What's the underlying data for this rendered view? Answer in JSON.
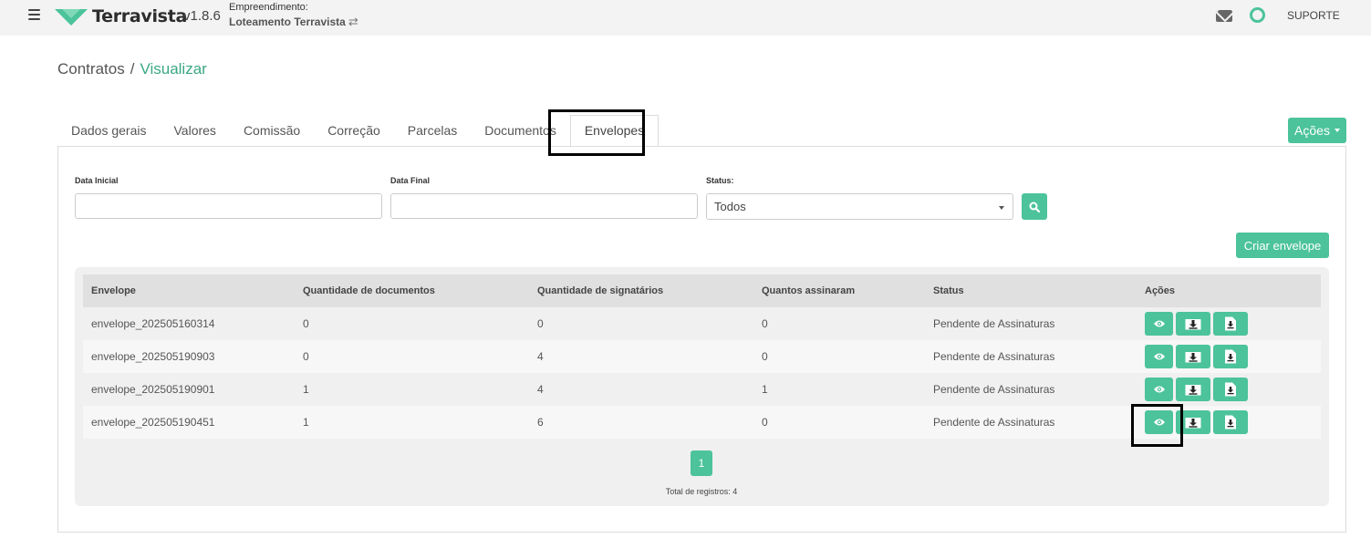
{
  "header": {
    "app_name": "Terravista",
    "version": "v1.8.6",
    "empreendimento_label": "Empreendimento:",
    "empreendimento_name": "Loteamento Terravista",
    "swap_glyph": "⇄",
    "support_label": "SUPORTE",
    "brand_color": "#4cc39a"
  },
  "breadcrumb": {
    "parent": "Contratos",
    "separator": "/",
    "current": "Visualizar"
  },
  "tabs": [
    {
      "label": "Dados gerais"
    },
    {
      "label": "Valores"
    },
    {
      "label": "Comissão"
    },
    {
      "label": "Correção"
    },
    {
      "label": "Parcelas"
    },
    {
      "label": "Documentos"
    },
    {
      "label": "Envelopes",
      "active": true
    }
  ],
  "actions_button": "Ações",
  "filters": {
    "data_inicial_label": "Data Inicial",
    "data_inicial_value": "",
    "data_final_label": "Data Final",
    "data_final_value": "",
    "status_label": "Status:",
    "status_value": "Todos"
  },
  "create_button": "Criar envelope",
  "table": {
    "headers": [
      "Envelope",
      "Quantidade de documentos",
      "Quantidade de signatários",
      "Quantos assinaram",
      "Status",
      "Ações"
    ],
    "rows": [
      {
        "envelope": "envelope_202505160314",
        "documentos": "0",
        "signatarios": "0",
        "assinaram": "0",
        "status": "Pendente de Assinaturas"
      },
      {
        "envelope": "envelope_202505190903",
        "documentos": "0",
        "signatarios": "4",
        "assinaram": "0",
        "status": "Pendente de Assinaturas"
      },
      {
        "envelope": "envelope_202505190901",
        "documentos": "1",
        "signatarios": "4",
        "assinaram": "1",
        "status": "Pendente de Assinaturas"
      },
      {
        "envelope": "envelope_202505190451",
        "documentos": "1",
        "signatarios": "6",
        "assinaram": "0",
        "status": "Pendente de Assinaturas"
      }
    ],
    "row_action_icons": [
      "eye-icon",
      "download-envelope-icon",
      "download-file-icon"
    ]
  },
  "pagination": {
    "current_page": "1"
  },
  "total_records": "Total de registros: 4"
}
